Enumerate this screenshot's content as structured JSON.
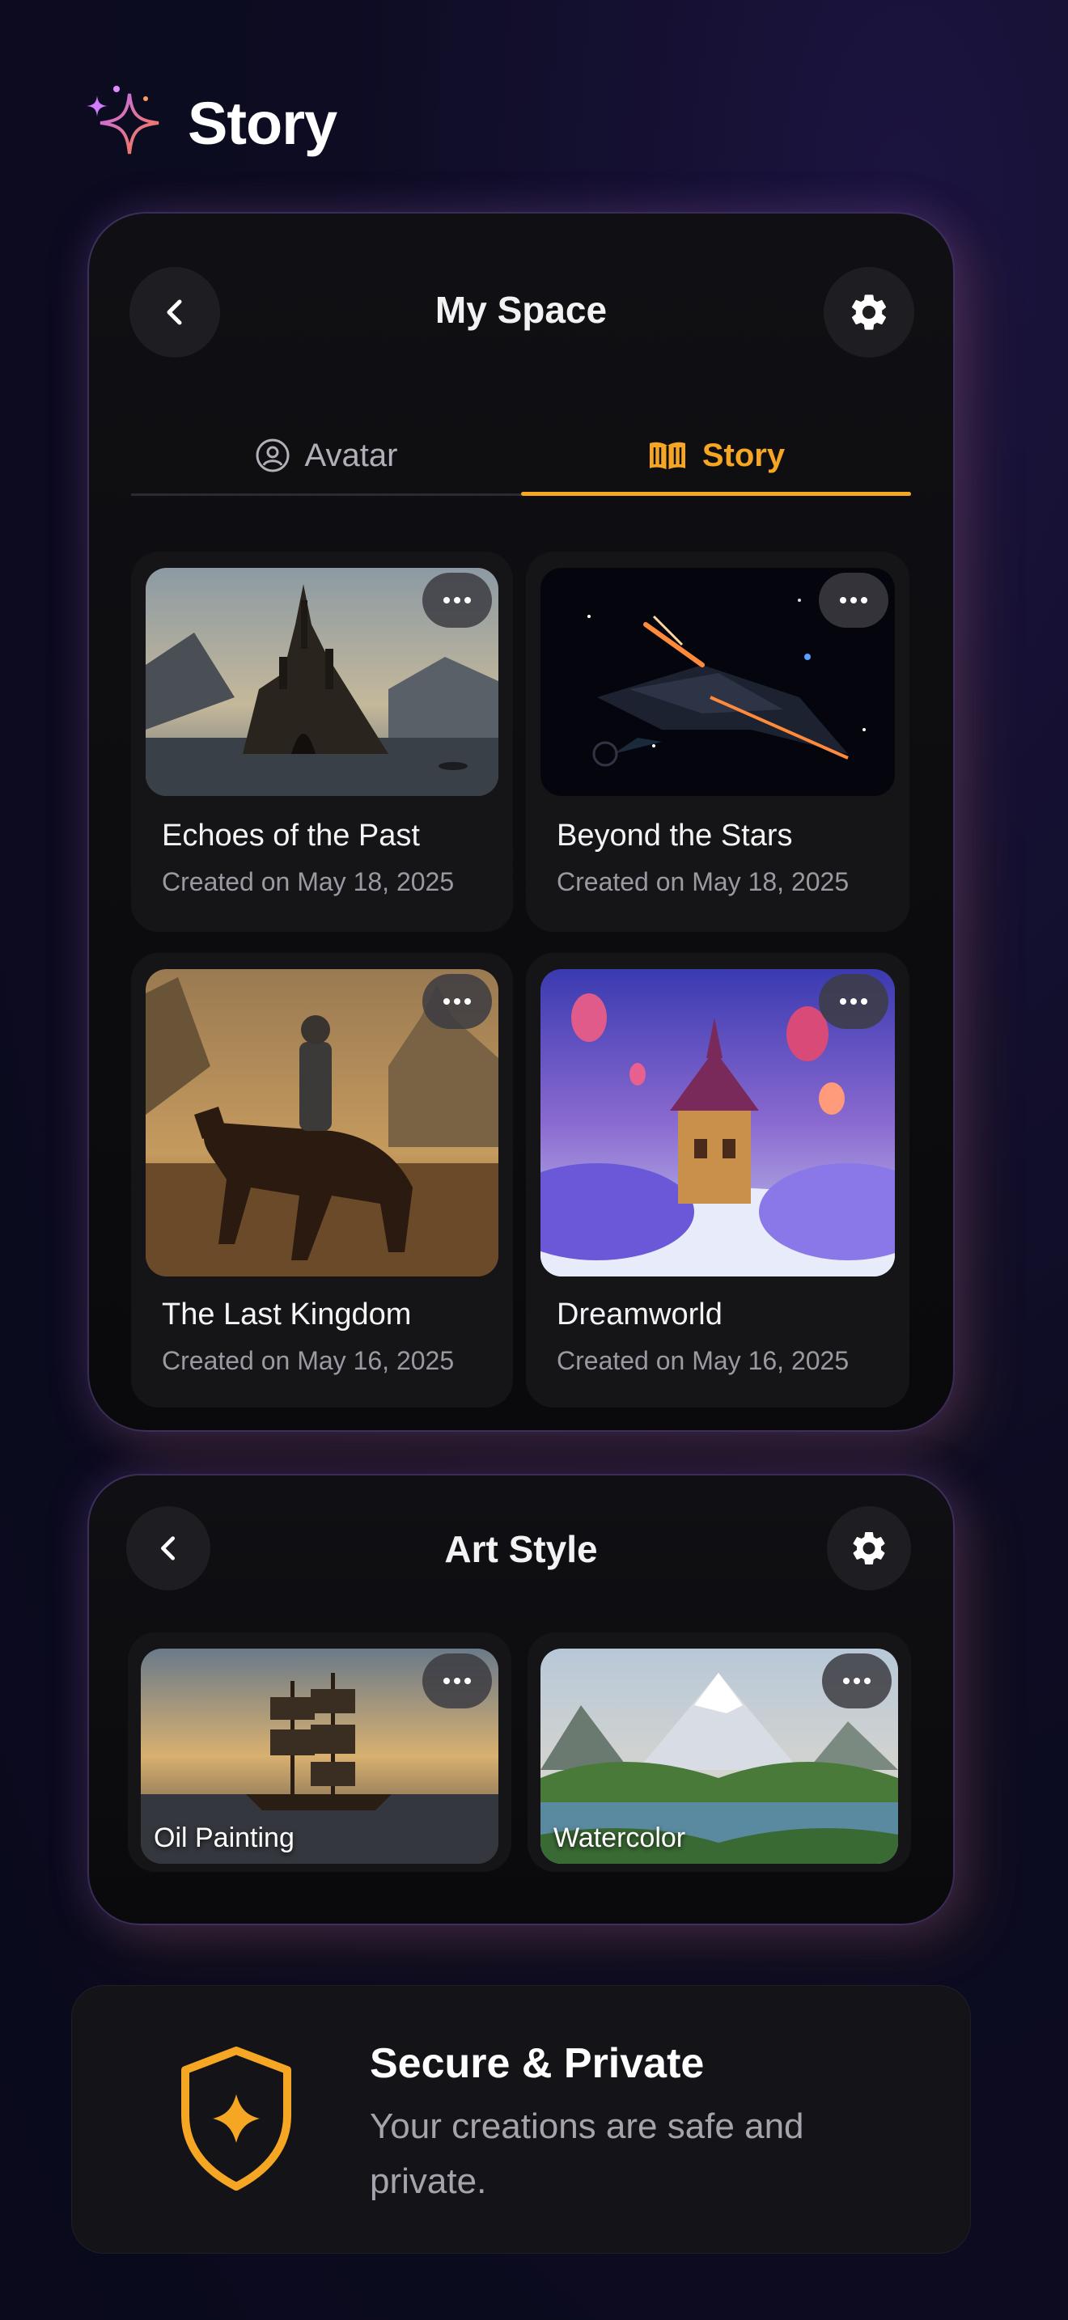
{
  "app": {
    "title": "Story"
  },
  "my_space": {
    "title": "My Space",
    "back_icon": "chevron-left-icon",
    "settings_icon": "gear-icon",
    "tabs": [
      {
        "label": "Avatar",
        "icon": "avatar-icon",
        "active": false
      },
      {
        "label": "Story",
        "icon": "book-icon",
        "active": true
      }
    ],
    "stories": [
      {
        "title": "Echoes of the Past",
        "date": "Created on May 18, 2025",
        "image": "castle-on-cliff"
      },
      {
        "title": "Beyond the Stars",
        "date": "Created on May 18, 2025",
        "image": "spaceship"
      },
      {
        "title": "The Last Kingdom",
        "date": "Created on May 16, 2025",
        "image": "knight-on-horse"
      },
      {
        "title": "Dreamworld",
        "date": "Created on May 16, 2025",
        "image": "floating-castle"
      }
    ]
  },
  "art_style": {
    "title": "Art Style",
    "styles": [
      {
        "label": "Oil Painting",
        "image": "sailing-ship"
      },
      {
        "label": "Watercolor",
        "image": "mountain-lake"
      }
    ]
  },
  "secure": {
    "title": "Secure & Private",
    "description": "Your creations are safe and private.",
    "icon": "shield-icon"
  },
  "colors": {
    "accent": "#f5a623",
    "panel_glow": "#8a5cf0",
    "background": "#0d0c22"
  }
}
